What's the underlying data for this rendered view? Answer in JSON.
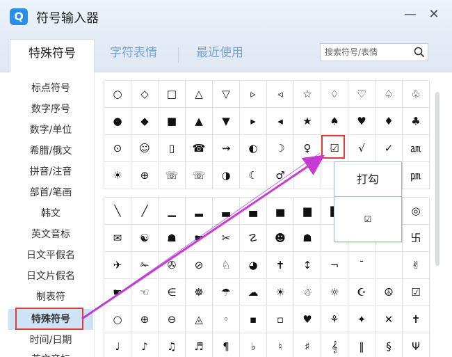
{
  "app": {
    "logo": "Q",
    "title": "符号输入器",
    "minimize": "—",
    "close": "✕"
  },
  "tabs": [
    {
      "label": "特殊符号",
      "active": true
    },
    {
      "label": "字符表情",
      "active": false
    },
    {
      "label": "最近使用",
      "active": false
    }
  ],
  "search": {
    "placeholder": "搜索符号/表情",
    "icon": "search-icon"
  },
  "sidebar": {
    "items": [
      {
        "label": "标点符号"
      },
      {
        "label": "数字序号"
      },
      {
        "label": "数字/单位"
      },
      {
        "label": "希腊/俄文"
      },
      {
        "label": "拼音/注音"
      },
      {
        "label": "部首/笔画"
      },
      {
        "label": "韩文"
      },
      {
        "label": "英文音标"
      },
      {
        "label": "日文平假名"
      },
      {
        "label": "日文片假名"
      },
      {
        "label": "制表符"
      },
      {
        "label": "特殊符号",
        "active": true
      },
      {
        "label": "时间/日期"
      },
      {
        "label": "英文音标"
      }
    ]
  },
  "grid1": [
    [
      "○",
      "◇",
      "□",
      "△",
      "▽",
      "▹",
      "◃",
      "☆",
      "♢",
      "♡",
      "♤",
      "♧"
    ],
    [
      "●",
      "◆",
      "■",
      "▲",
      "▼",
      "▸",
      "◂",
      "★",
      "♠",
      "♥",
      "♦",
      "♣"
    ],
    [
      "⊙",
      "☺",
      "▯",
      "☎",
      "⇝",
      "◐",
      "☽",
      "♀",
      "☑",
      "√",
      "✓",
      "㏂"
    ],
    [
      "☀",
      "⊕",
      "☏",
      "☏",
      "◑",
      "☾",
      "♂",
      "",
      "",
      "",
      "",
      "㏘"
    ]
  ],
  "grid2": [
    [
      "╲",
      "╱",
      "▁",
      "▂",
      "▃",
      "▄",
      "▅",
      "▆",
      "▇",
      "",
      "",
      "◎"
    ],
    [
      "✉",
      "☯",
      "☗",
      "☛",
      "✂",
      "☡",
      "☻",
      "☗",
      "",
      "",
      "",
      "卐"
    ],
    [
      "✈",
      "✁",
      "✇",
      "⊘",
      "♘",
      "◕",
      "✝",
      "↕",
      "¬",
      "¯",
      "",
      "✌"
    ],
    [
      "☛",
      "☜",
      "∈",
      "☸",
      "☂",
      "☁",
      "☀",
      "☃",
      "☼",
      "☪",
      "☮",
      "☑"
    ],
    [
      "○",
      "⊕",
      "⊖",
      "◬",
      "◦",
      "▪",
      "▫",
      "♥",
      "⚘",
      "✦",
      "✕",
      "✝"
    ],
    [
      "♩",
      "♪",
      "♫",
      "♬",
      "¶",
      "♭",
      "♮",
      "♯",
      "𝄞",
      "‖",
      "§",
      "Ψ"
    ]
  ],
  "tooltip": {
    "name": "打勾",
    "symbol": "☑"
  },
  "colors": {
    "accent": "#2a8ee8",
    "highlight": "#e03a3a",
    "arrow": "#c83ad0",
    "active_tab_bg": "#cfe3f6"
  }
}
